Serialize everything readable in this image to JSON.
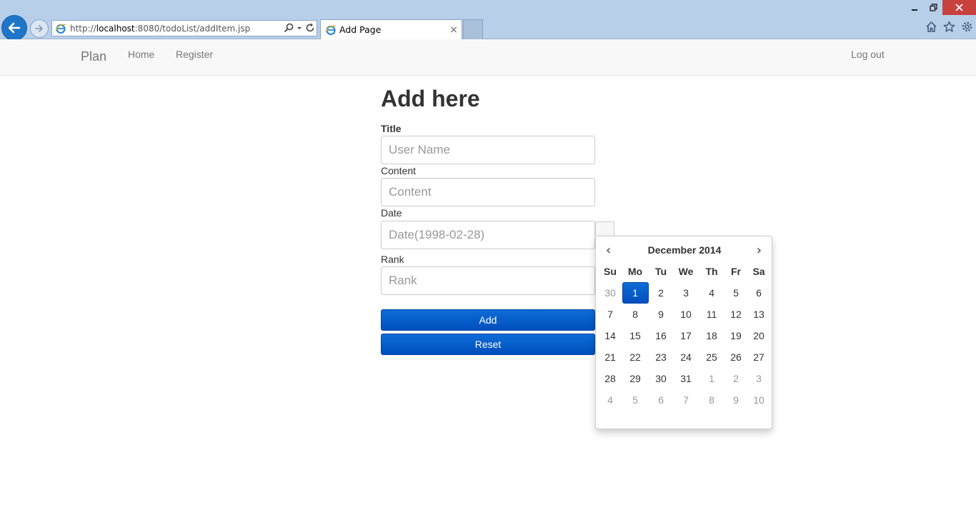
{
  "browser": {
    "url_prefix": "http://",
    "url_host": "localhost",
    "url_rest": ":8080/todoList/addItem.jsp",
    "tab_title": "Add Page",
    "tab_close": "×"
  },
  "navbar": {
    "brand": "Plan",
    "links": [
      "Home",
      "Register"
    ],
    "logout": "Log out"
  },
  "form": {
    "heading": "Add here",
    "title_label": "Title",
    "title_placeholder": "User Name",
    "content_label": "Content",
    "content_placeholder": "Content",
    "date_label": "Date",
    "date_placeholder": "Date(1998-02-28)",
    "rank_label": "Rank",
    "rank_placeholder": "Rank",
    "add_button": "Add",
    "reset_button": "Reset"
  },
  "datepicker": {
    "prev": "‹",
    "next": "›",
    "month_year": "December 2014",
    "weekdays": [
      "Su",
      "Mo",
      "Tu",
      "We",
      "Th",
      "Fr",
      "Sa"
    ],
    "weeks": [
      [
        "30",
        "1",
        "2",
        "3",
        "4",
        "5",
        "6"
      ],
      [
        "7",
        "8",
        "9",
        "10",
        "11",
        "12",
        "13"
      ],
      [
        "14",
        "15",
        "16",
        "17",
        "18",
        "19",
        "20"
      ],
      [
        "21",
        "22",
        "23",
        "24",
        "25",
        "26",
        "27"
      ],
      [
        "28",
        "29",
        "30",
        "31",
        "1",
        "2",
        "3"
      ],
      [
        "4",
        "5",
        "6",
        "7",
        "8",
        "9",
        "10"
      ]
    ],
    "selected_day": "1"
  },
  "colors": {
    "primary": "#0e6cd6",
    "chrome": "#b7cfe9",
    "navbar": "#f8f8f8"
  }
}
